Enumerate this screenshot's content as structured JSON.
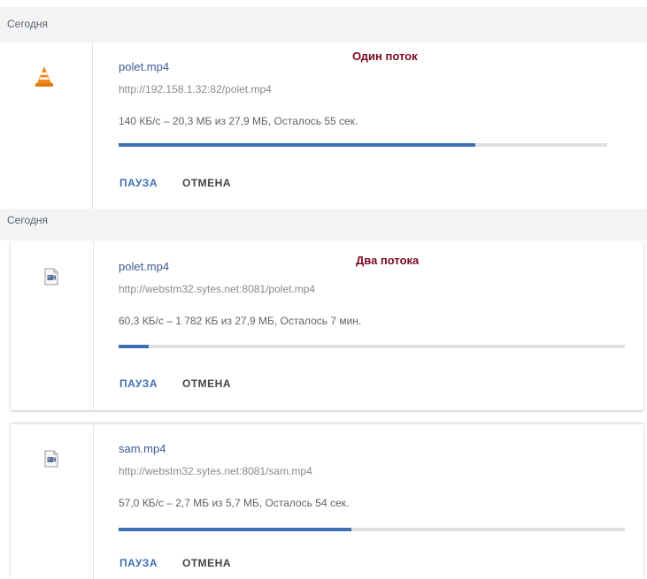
{
  "sections": [
    {
      "heading": "Сегодня"
    },
    {
      "heading": "Сегодня"
    }
  ],
  "annotations": [
    "Один поток",
    "Два потока"
  ],
  "downloads": [
    {
      "name": "polet.mp4",
      "url": "http://192.158.1.32:82/polet.mp4",
      "status": "140 КБ/с – 20,3 МБ из 27,9 МБ, Осталось 55 сек.",
      "progress": 0.73,
      "icon": "vlc-cone-icon",
      "pause_label": "ПАУЗА",
      "cancel_label": "ОТМЕНА"
    },
    {
      "name": "polet.mp4",
      "url": "http://webstm32.sytes.net:8081/polet.mp4",
      "status": "60,3 КБ/с – 1 782 КБ из 27,9 МБ, Осталось 7 мин.",
      "progress": 0.06,
      "icon": "video-file-icon",
      "pause_label": "ПАУЗА",
      "cancel_label": "ОТМЕНА"
    },
    {
      "name": "sam.mp4",
      "url": "http://webstm32.sytes.net:8081/sam.mp4",
      "status": "57,0 КБ/с – 2,7 МБ из 5,7 МБ, Осталось 54 сек.",
      "progress": 0.46,
      "icon": "video-file-icon",
      "pause_label": "ПАУЗА",
      "cancel_label": "ОТМЕНА"
    }
  ],
  "colors": {
    "accent": "#3d6fb4",
    "annotation": "#7a0a22",
    "vlc_orange": "#f08a1d"
  }
}
